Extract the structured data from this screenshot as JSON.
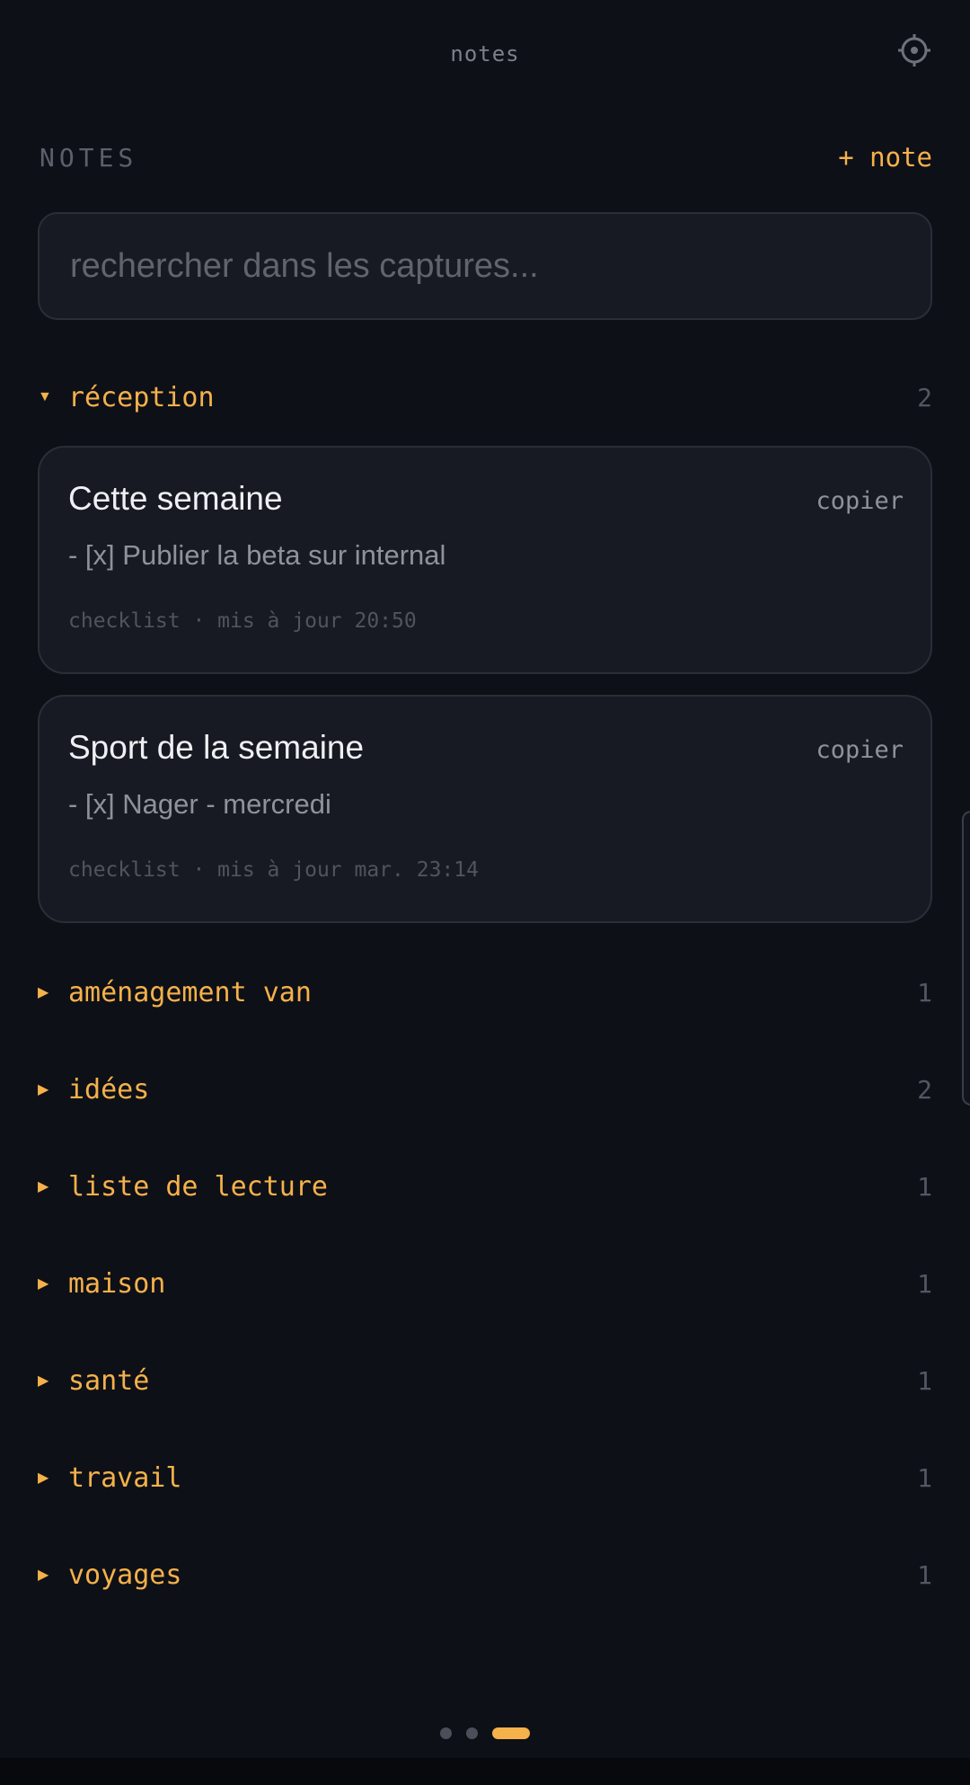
{
  "header": {
    "title": "notes",
    "settings_icon": "gear-icon"
  },
  "section": {
    "label": "NOTES",
    "add_label": "+ note"
  },
  "search": {
    "placeholder": "rechercher dans les captures..."
  },
  "colors": {
    "accent": "#f5b14a",
    "background": "#0e1017",
    "card": "#171a22"
  },
  "groups": [
    {
      "name": "réception",
      "count": "2",
      "expanded": true,
      "notes": [
        {
          "title": "Cette semaine",
          "copy_label": "copier",
          "preview": "- [x] Publier la beta sur internal",
          "meta": "checklist · mis à jour 20:50"
        },
        {
          "title": "Sport de la semaine",
          "copy_label": "copier",
          "preview": "- [x] Nager - mercredi",
          "meta": "checklist · mis à jour mar. 23:14"
        }
      ]
    },
    {
      "name": "aménagement van",
      "count": "1",
      "expanded": false
    },
    {
      "name": "idées",
      "count": "2",
      "expanded": false
    },
    {
      "name": "liste de lecture",
      "count": "1",
      "expanded": false
    },
    {
      "name": "maison",
      "count": "1",
      "expanded": false
    },
    {
      "name": "santé",
      "count": "1",
      "expanded": false
    },
    {
      "name": "travail",
      "count": "1",
      "expanded": false
    },
    {
      "name": "voyages",
      "count": "1",
      "expanded": false
    }
  ],
  "pager": {
    "pages": 3,
    "active_index": 2
  }
}
